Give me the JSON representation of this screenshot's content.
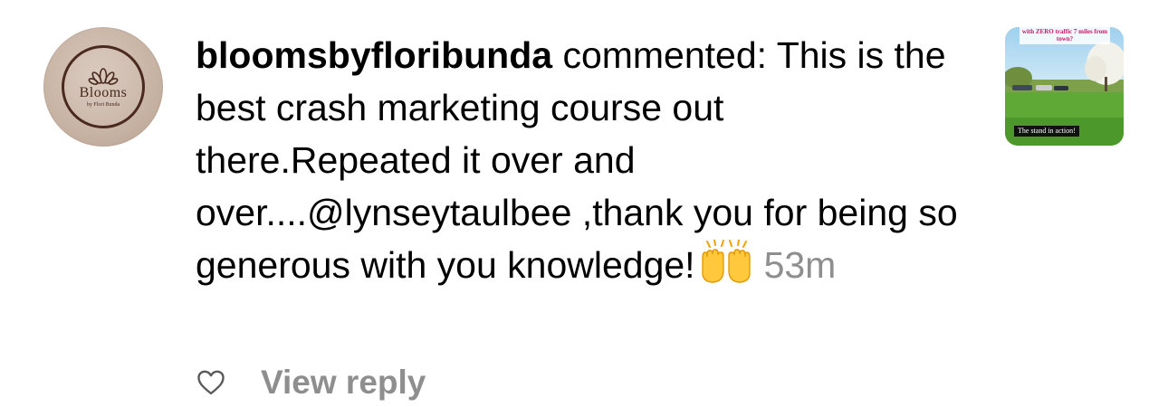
{
  "avatar": {
    "brand": "Blooms",
    "subtitle": "by Flori Bunda",
    "icon": "flower-icon"
  },
  "comment": {
    "username": "bloomsbyfloribunda",
    "action_text": " commented: This is the best crash marketing course out there.Repeated it over and over....@lynseytaulbee ,thank you for being so generous with you knowledge!",
    "emoji": "raising-hands-icon",
    "time": "53m"
  },
  "post_thumbnail": {
    "banner_text": "with ZERO traffic 7 miles from town?",
    "caption": "The stand in action!"
  },
  "actions": {
    "like_icon": "heart-icon",
    "view_reply_label": "View reply"
  },
  "colors": {
    "text": "#000000",
    "muted": "#8e8e8e",
    "banner_text": "#c8186a"
  }
}
